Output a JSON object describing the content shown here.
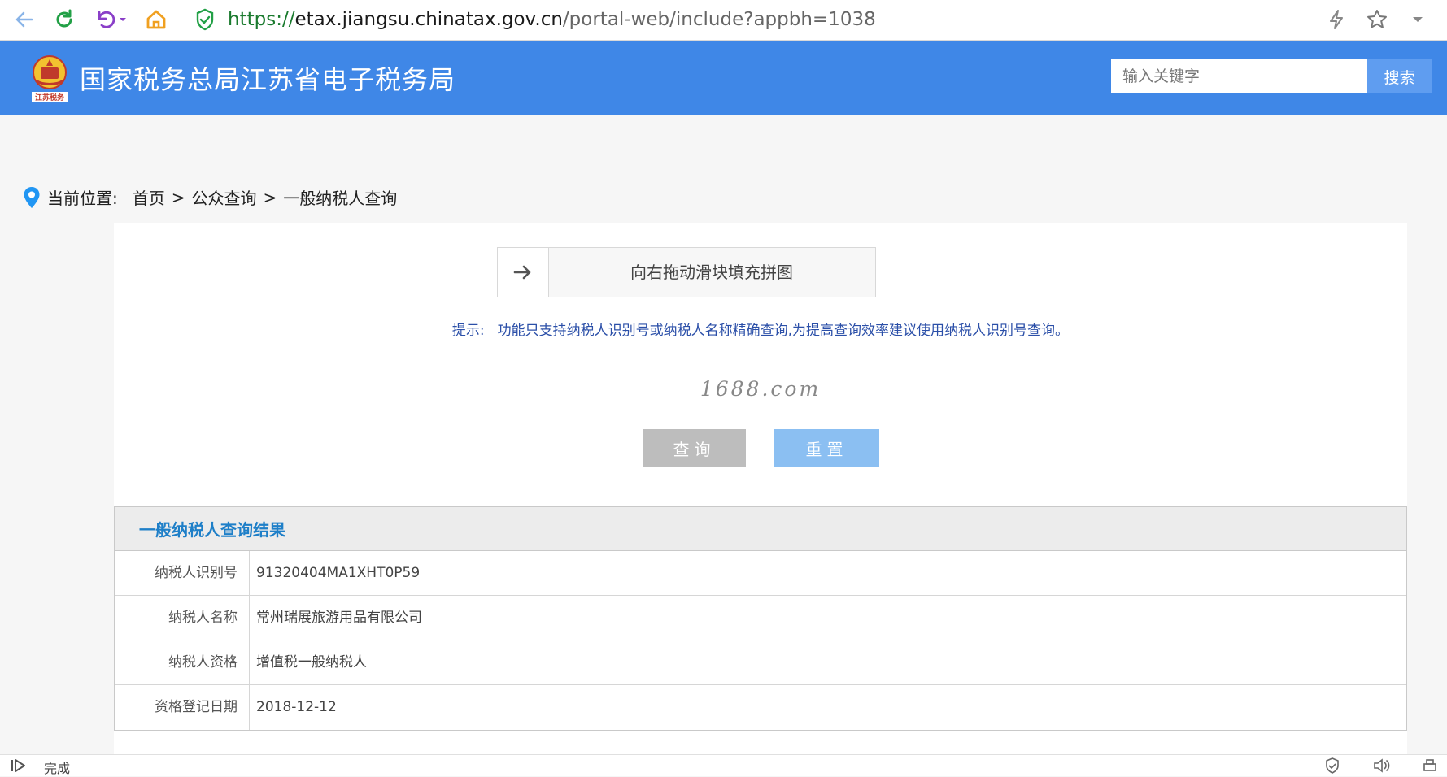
{
  "browser": {
    "url_scheme": "https://",
    "url_host": "etax.jiangsu.chinatax.gov.cn",
    "url_path": "/portal-web/include?appbh=1038",
    "icons": [
      "back-icon",
      "refresh-icon",
      "undo-icon",
      "home-icon",
      "secure-shield-icon",
      "lightning-icon",
      "star-icon",
      "dropdown-icon"
    ]
  },
  "header": {
    "title": "国家税务总局江苏省电子税务局",
    "emblem_caption": "江苏税务",
    "search_placeholder": "输入关键字",
    "search_button": "搜索",
    "brand_color": "#3f87e7"
  },
  "breadcrumb": {
    "label": "当前位置:",
    "items": [
      "首页",
      "公众查询",
      "一般纳税人查询"
    ],
    "separator": ">"
  },
  "captcha": {
    "slider_text": "向右拖动滑块填充拼图"
  },
  "hint": {
    "label": "提示:",
    "text": "功能只支持纳税人识别号或纳税人名称精确查询,为提高查询效率建议使用纳税人识别号查询。"
  },
  "watermark": "1688.com",
  "buttons": {
    "query": "查询",
    "reset": "重置"
  },
  "result": {
    "title": "一般纳税人查询结果",
    "rows": [
      {
        "label": "纳税人识别号",
        "value": "91320404MA1XHT0P59"
      },
      {
        "label": "纳税人名称",
        "value": "常州瑞展旅游用品有限公司"
      },
      {
        "label": "纳税人资格",
        "value": "增值税一般纳税人"
      },
      {
        "label": "资格登记日期",
        "value": "2018-12-12"
      }
    ]
  },
  "status_bar": {
    "text": "完成"
  }
}
